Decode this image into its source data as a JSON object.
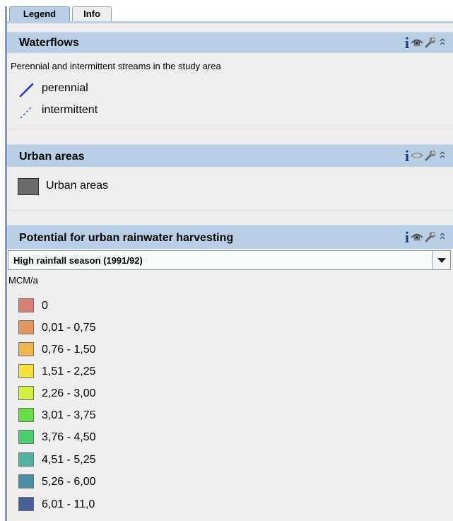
{
  "tabs": {
    "legend": "Legend",
    "info": "Info"
  },
  "layers": [
    {
      "title": "Waterflows",
      "description": "Perennial and intermittent streams in the study area",
      "symbols": [
        "perennial",
        "intermittent"
      ],
      "visible": true
    },
    {
      "title": "Urban areas",
      "symbols": [
        "Urban areas"
      ],
      "visible": false
    },
    {
      "title": "Potential for urban rainwater harvesting",
      "dropdown_value": "High rainfall season (1991/92)",
      "unit": "MCM/a",
      "visible": true,
      "classes": [
        {
          "label": "0",
          "color": "#d77f73"
        },
        {
          "label": "0,01 - 0,75",
          "color": "#e5965e"
        },
        {
          "label": "0,76 - 1,50",
          "color": "#efb84f"
        },
        {
          "label": "1,51 - 2,25",
          "color": "#f5e03c"
        },
        {
          "label": "2,26 - 3,00",
          "color": "#d2f03f"
        },
        {
          "label": "3,01 - 3,75",
          "color": "#64e046"
        },
        {
          "label": "3,76 - 4,50",
          "color": "#4ccd70"
        },
        {
          "label": "4,51 - 5,25",
          "color": "#4fb3a0"
        },
        {
          "label": "5,26 - 6,00",
          "color": "#4a8fa5"
        },
        {
          "label": "6,01 - 11,0",
          "color": "#465f9b"
        }
      ]
    }
  ],
  "icons": {
    "info": "info-icon",
    "visibility": "eye-icon",
    "settings": "wrench-icon",
    "collapse": "chevron-up-double-icon"
  },
  "colors": {
    "header_bg": "#b8cfe5",
    "panel_bg": "#eeeeee",
    "perennial_line": "#1f2fe0",
    "intermittent_line": "#2a5bd8",
    "urban_fill": "#6b6b6b"
  }
}
